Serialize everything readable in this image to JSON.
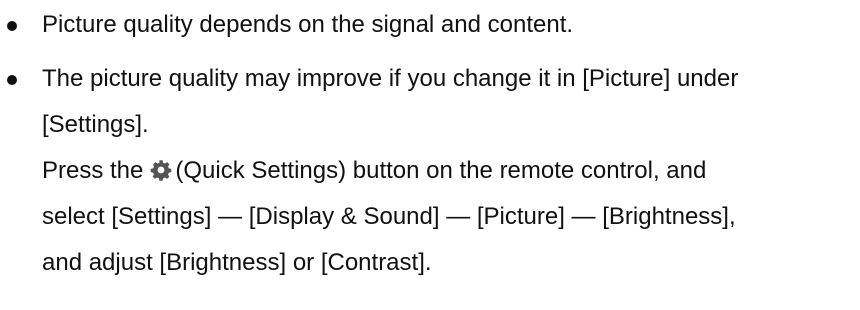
{
  "bullets": [
    {
      "text": "Picture quality depends on the signal and content."
    },
    {
      "line1": "The picture quality may improve if you change it in [Picture] under",
      "line2": "[Settings].",
      "line3_before": "Press the",
      "icon": "gear-icon",
      "line3_after": "(Quick Settings) button on the remote control, and",
      "line4": "select [Settings] — [Display & Sound] — [Picture] — [Brightness],",
      "line5": "and adjust [Brightness] or [Contrast]."
    }
  ]
}
